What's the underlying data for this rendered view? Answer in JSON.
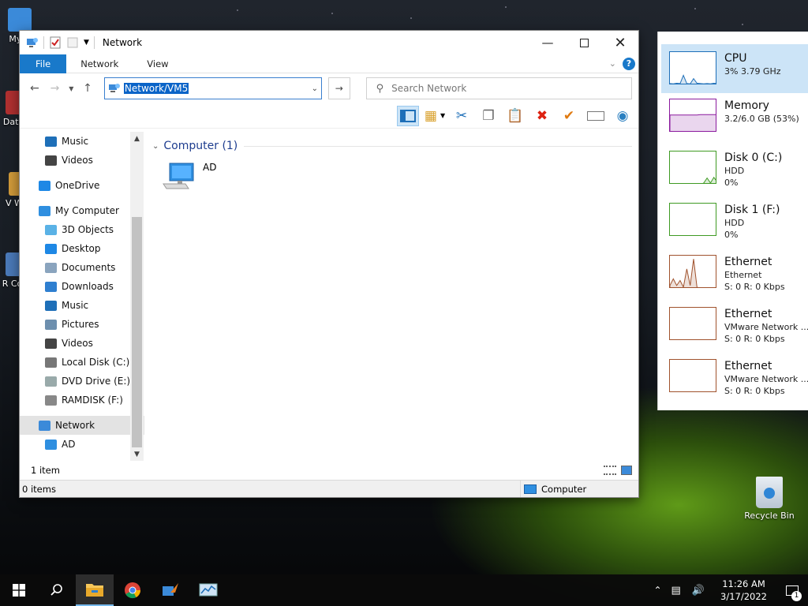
{
  "desktop": {
    "icons": [
      {
        "name": "desktop-icon-my-computer",
        "label": "My C"
      },
      {
        "name": "desktop-icon-data",
        "label": "Data"
      },
      {
        "name": "desktop-icon-v",
        "label": "V Wo"
      },
      {
        "name": "desktop-icon-r",
        "label": "R Con"
      }
    ],
    "recycle_bin": "Recycle Bin"
  },
  "explorer": {
    "title": "Network",
    "ribbon_tabs": [
      "File",
      "Network",
      "View"
    ],
    "address": "Network/VM5",
    "search_placeholder": "Search Network",
    "nav_items": [
      {
        "label": "Music",
        "indent": 2,
        "icon": "music-icon"
      },
      {
        "label": "Videos",
        "indent": 2,
        "icon": "videos-icon"
      },
      {
        "label": "OneDrive",
        "indent": 1,
        "icon": "onedrive-icon"
      },
      {
        "label": "My Computer",
        "indent": 1,
        "icon": "computer-icon"
      },
      {
        "label": "3D Objects",
        "indent": 2,
        "icon": "3d-objects-icon"
      },
      {
        "label": "Desktop",
        "indent": 2,
        "icon": "desktop-folder-icon"
      },
      {
        "label": "Documents",
        "indent": 2,
        "icon": "documents-icon"
      },
      {
        "label": "Downloads",
        "indent": 2,
        "icon": "downloads-icon"
      },
      {
        "label": "Music",
        "indent": 2,
        "icon": "music-icon"
      },
      {
        "label": "Pictures",
        "indent": 2,
        "icon": "pictures-icon"
      },
      {
        "label": "Videos",
        "indent": 2,
        "icon": "videos-icon"
      },
      {
        "label": "Local Disk (C:)",
        "indent": 2,
        "icon": "local-disk-icon"
      },
      {
        "label": "DVD Drive (E:) CI",
        "indent": 2,
        "icon": "dvd-drive-icon"
      },
      {
        "label": "RAMDISK (F:)",
        "indent": 2,
        "icon": "ramdisk-icon"
      },
      {
        "label": "Network",
        "indent": 1,
        "icon": "network-icon",
        "selected": true
      },
      {
        "label": "AD",
        "indent": 2,
        "icon": "computer-icon"
      }
    ],
    "group_header": "Computer (1)",
    "items": [
      {
        "label": "AD"
      }
    ],
    "item_count": "1 item",
    "status_items": "0 items",
    "status_zone": "Computer"
  },
  "performance": [
    {
      "title": "CPU",
      "line1": "3% 3.79 GHz",
      "line2": "",
      "color": "#1e6fb8",
      "active": true,
      "levels": [
        0.05,
        0.04,
        0.06,
        0.05,
        0.3,
        0.05,
        0.04,
        0.2,
        0.06,
        0.05,
        0.04,
        0.05,
        0.04,
        0.06,
        0.05
      ]
    },
    {
      "title": "Memory",
      "line1": "3.2/6.0 GB (53%)",
      "line2": "",
      "color": "#8b1a9e",
      "active": false,
      "levels": [
        0.53,
        0.53,
        0.53,
        0.53,
        0.53,
        0.53,
        0.53,
        0.53,
        0.53,
        0.54,
        0.54,
        0.54,
        0.54,
        0.54,
        0.54
      ]
    },
    {
      "title": "Disk 0 (C:)",
      "line1": "HDD",
      "line2": "0%",
      "color": "#3f9a23",
      "active": false,
      "levels": [
        0,
        0,
        0,
        0,
        0,
        0,
        0,
        0,
        0,
        0,
        0.05,
        0.2,
        0.05,
        0.22,
        0.08
      ]
    },
    {
      "title": "Disk 1 (F:)",
      "line1": "HDD",
      "line2": "0%",
      "color": "#3f9a23",
      "active": false,
      "levels": [
        0,
        0,
        0,
        0,
        0,
        0,
        0,
        0,
        0,
        0,
        0,
        0,
        0,
        0,
        0
      ]
    },
    {
      "title": "Ethernet",
      "line1": "Ethernet",
      "line2": "S: 0 R: 0 Kbps",
      "color": "#a0522d",
      "active": false,
      "levels": [
        0.1,
        0.3,
        0.1,
        0.25,
        0.05,
        0.6,
        0.1,
        0.9,
        0.05,
        0,
        0,
        0,
        0,
        0,
        0
      ]
    },
    {
      "title": "Ethernet",
      "line1": "VMware Network ...",
      "line2": "S: 0 R: 0 Kbps",
      "color": "#a0522d",
      "active": false,
      "levels": [
        0,
        0,
        0,
        0,
        0,
        0,
        0,
        0,
        0,
        0,
        0,
        0,
        0,
        0,
        0
      ]
    },
    {
      "title": "Ethernet",
      "line1": "VMware Network ...",
      "line2": "S: 0 R: 0 Kbps",
      "color": "#a0522d",
      "active": false,
      "levels": [
        0,
        0,
        0,
        0,
        0,
        0,
        0,
        0,
        0,
        0,
        0,
        0,
        0,
        0,
        0
      ]
    }
  ],
  "taskbar": {
    "apps": [
      "start-button",
      "search-button",
      "file-explorer-app",
      "chrome-app",
      "tool-app",
      "task-manager-app"
    ],
    "time": "11:26 AM",
    "date": "3/17/2022",
    "notifications": "1"
  }
}
